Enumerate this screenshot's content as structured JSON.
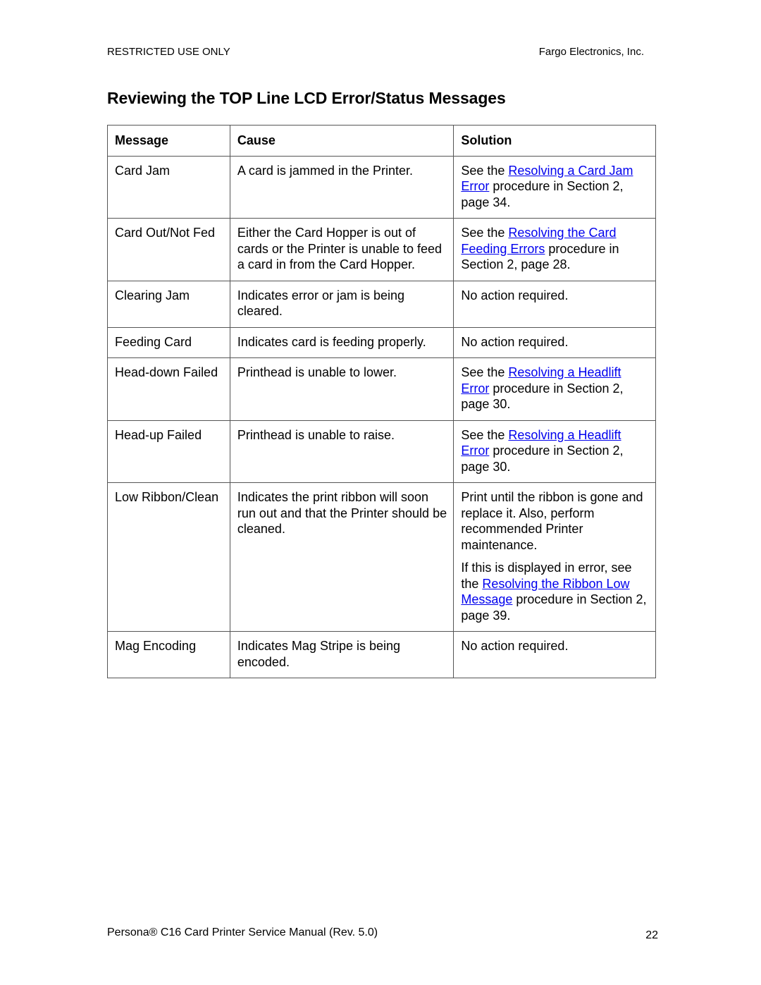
{
  "header": {
    "left": "RESTRICTED USE ONLY",
    "right": "Fargo Electronics, Inc."
  },
  "title": "Reviewing the TOP Line LCD Error/Status Messages",
  "table": {
    "columns": [
      "Message",
      "Cause",
      "Solution"
    ],
    "rows": [
      {
        "message": "Card Jam",
        "cause": "A card is jammed in the Printer.",
        "solution": [
          {
            "before": "See the ",
            "link": "Resolving a Card Jam Error",
            "after": " procedure in Section 2, page 34."
          }
        ]
      },
      {
        "message": "Card Out/Not Fed",
        "cause": "Either the Card Hopper is out of cards or the Printer is unable to feed a card in from the Card Hopper.",
        "solution": [
          {
            "before": "See the ",
            "link": "Resolving the Card Feeding Errors",
            "after": " procedure in Section 2, page 28."
          }
        ]
      },
      {
        "message": "Clearing Jam",
        "cause": "Indicates error or jam is being cleared.",
        "solution": [
          {
            "before": "No action required.",
            "link": "",
            "after": ""
          }
        ]
      },
      {
        "message": "Feeding Card",
        "cause": "Indicates card is feeding properly.",
        "solution": [
          {
            "before": "No action required.",
            "link": "",
            "after": ""
          }
        ]
      },
      {
        "message": "Head-down Failed",
        "cause": "Printhead is unable to lower.",
        "solution": [
          {
            "before": "See the ",
            "link": "Resolving a Headlift Error",
            "after": " procedure in Section 2, page 30."
          }
        ]
      },
      {
        "message": "Head-up Failed",
        "cause": "Printhead is unable to raise.",
        "solution": [
          {
            "before": "See the ",
            "link": "Resolving a Headlift Error",
            "after": " procedure in Section 2, page 30."
          }
        ]
      },
      {
        "message": "Low Ribbon/Clean",
        "cause": "Indicates the print ribbon will soon run out and that the Printer should be cleaned.",
        "solution": [
          {
            "before": "Print until the ribbon is gone and replace it. Also, perform recommended Printer maintenance.",
            "link": "",
            "after": ""
          },
          {
            "before": "If this is displayed in error, see the ",
            "link": "Resolving the Ribbon Low Message",
            "after": " procedure in Section 2, page 39."
          }
        ]
      },
      {
        "message": "Mag Encoding",
        "cause": "Indicates Mag Stripe is being encoded.",
        "solution": [
          {
            "before": "No action required.",
            "link": "",
            "after": ""
          }
        ]
      }
    ]
  },
  "footer": {
    "left": "Persona® C16 Card Printer Service Manual (Rev. 5.0)",
    "page_number": "22"
  },
  "colors": {
    "link": "#0000ee",
    "border": "#555555",
    "text": "#000000"
  }
}
